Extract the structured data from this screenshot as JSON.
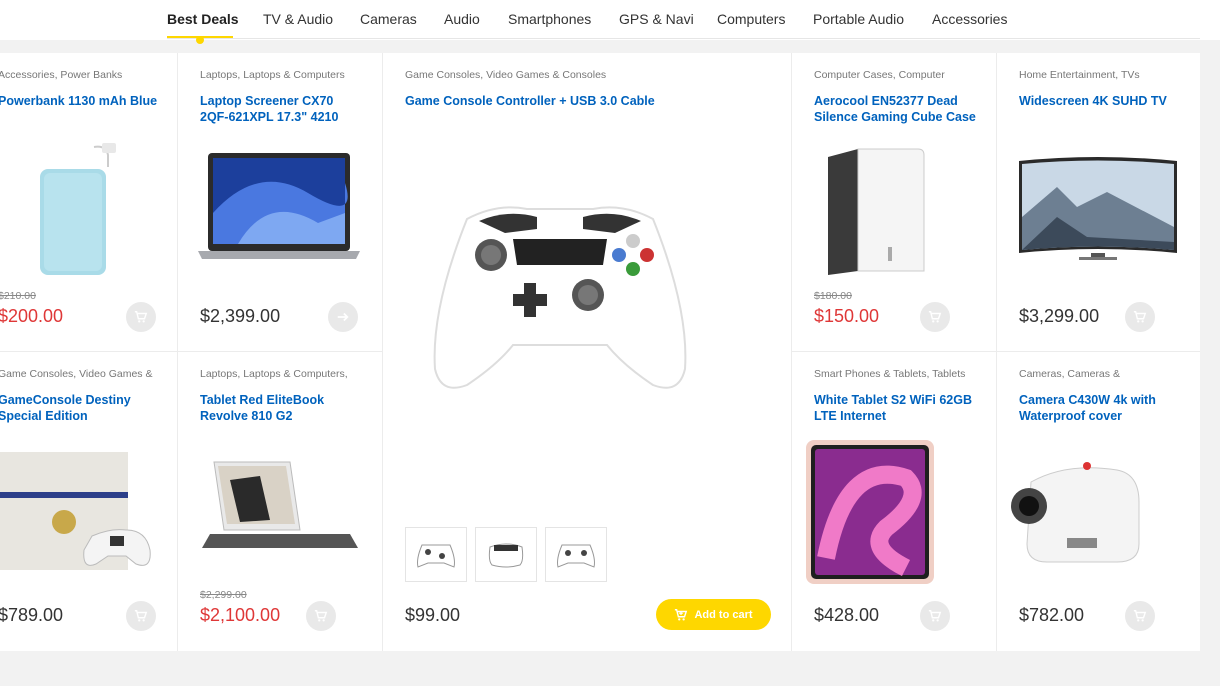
{
  "tabs": [
    {
      "label": "Best Deals",
      "active": true
    },
    {
      "label": "TV & Audio"
    },
    {
      "label": "Cameras"
    },
    {
      "label": "Audio"
    },
    {
      "label": "Smartphones"
    },
    {
      "label": "GPS & Navi"
    },
    {
      "label": "Computers"
    },
    {
      "label": "Portable Audio"
    },
    {
      "label": "Accessories"
    }
  ],
  "colors": {
    "accent": "#fed700",
    "link": "#0062bd",
    "sale": "#df3737"
  },
  "products": {
    "powerbank": {
      "category": "Accessories, Power Banks",
      "title": "Powerbank 1130 mAh Blue",
      "old_price": "$210.00",
      "price": "$200.00",
      "icon": "cart-icon"
    },
    "laptop": {
      "category": "Laptops, Laptops & Computers",
      "title": "Laptop Screener CX70 2QF-621XPL 17.3\" 4210",
      "price": "$2,399.00",
      "icon": "arrow-right-icon"
    },
    "controller": {
      "category": "Game Consoles, Video Games & Consoles",
      "title": "Game Console Controller + USB 3.0 Cable",
      "price": "$99.00",
      "add_label": "Add to cart",
      "thumbnails": [
        "controller-white-front",
        "controller-white-top",
        "controller-white-angle"
      ]
    },
    "case": {
      "category": "Computer Cases, Computer",
      "title": "Aerocool EN52377 Dead Silence Gaming Cube Case",
      "old_price": "$180.00",
      "price": "$150.00",
      "icon": "cart-icon"
    },
    "tv": {
      "category": "Home Entertainment, TVs",
      "title": "Widescreen 4K SUHD TV",
      "price": "$3,299.00",
      "icon": "cart-icon"
    },
    "console": {
      "category": "Game Consoles, Video Games &",
      "title": "GameConsole Destiny Special Edition",
      "price": "$789.00",
      "icon": "cart-icon"
    },
    "tablet_red": {
      "category": "Laptops, Laptops & Computers,",
      "title": "Tablet Red EliteBook Revolve 810 G2",
      "old_price": "$2,299.00",
      "price": "$2,100.00",
      "icon": "cart-icon"
    },
    "tablet_white": {
      "category": "Smart Phones & Tablets, Tablets",
      "title": "White Tablet S2 WiFi 62GB LTE Internet",
      "price": "$428.00",
      "icon": "cart-icon"
    },
    "camera": {
      "category": "Cameras, Cameras &",
      "title": "Camera C430W 4k with Waterproof cover",
      "price": "$782.00",
      "icon": "cart-icon"
    }
  }
}
